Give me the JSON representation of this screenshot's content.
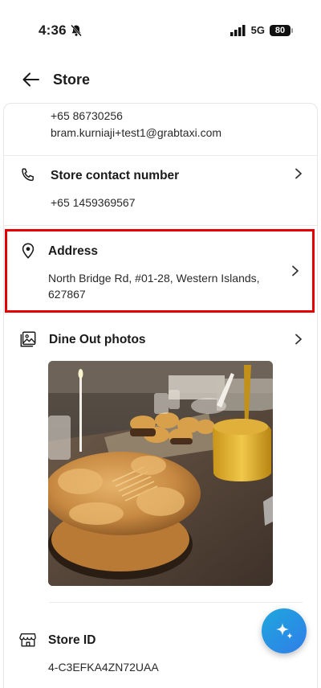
{
  "status_bar": {
    "time": "4:36",
    "network": "5G",
    "battery": "80"
  },
  "header": {
    "title": "Store"
  },
  "owner": {
    "phone": "+65 86730256",
    "email": "bram.kurniaji+test1@grabtaxi.com"
  },
  "store_contact": {
    "label": "Store contact number",
    "value": "+65 1459369567"
  },
  "address": {
    "label": "Address",
    "line1": "North Bridge Rd, #01-28, Western Islands,",
    "line2": "627867"
  },
  "dine_out": {
    "label": "Dine Out photos"
  },
  "store_id": {
    "label": "Store ID",
    "value": "4-C3EFKA4ZN72UAA"
  },
  "colors": {
    "highlight": "#e40000",
    "fab_start": "#1fa7dd",
    "fab_end": "#2f7ee8"
  }
}
